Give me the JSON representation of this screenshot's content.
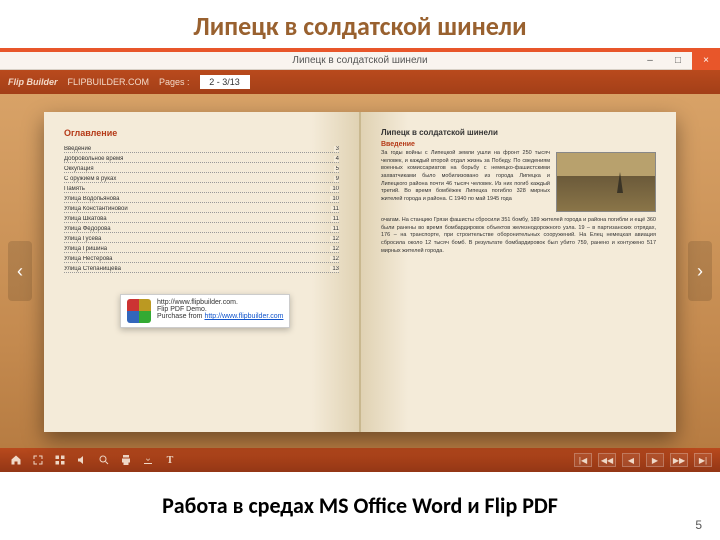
{
  "slide": {
    "title": "Липецк в солдатской шинели",
    "caption": "Работа в средах MS Office Word и Flip PDF",
    "pageNumber": "5"
  },
  "window": {
    "title": "Липецк в солдатской шинели",
    "minimize": "–",
    "maximize": "□",
    "close": "×"
  },
  "topbar": {
    "brand": "Flip Builder",
    "site": "FLIPBUILDER.COM",
    "pagesLabel": "Pages :",
    "pagesValue": "2 - 3/13"
  },
  "toc": {
    "title": "Оглавление",
    "items": [
      {
        "label": "Введение",
        "page": "3"
      },
      {
        "label": "Добровольное время",
        "page": "4"
      },
      {
        "label": "Оккупация",
        "page": "5"
      },
      {
        "label": "С оружием в руках",
        "page": "9"
      },
      {
        "label": "Память",
        "page": "10"
      },
      {
        "label": "Улица Водопьянова",
        "page": "10"
      },
      {
        "label": "Улица Константиновой",
        "page": "11"
      },
      {
        "label": "Улица Шкатова",
        "page": "11"
      },
      {
        "label": "Улица Фёдорова",
        "page": "11"
      },
      {
        "label": "Улица Гусева",
        "page": "12"
      },
      {
        "label": "Улица Гришина",
        "page": "12"
      },
      {
        "label": "Улица Нестерова",
        "page": "12"
      },
      {
        "label": "Улица Степанищева",
        "page": "13"
      }
    ]
  },
  "article": {
    "title": "Липецк в солдатской шинели",
    "sub": "Введение",
    "para1": "За годы войны с Липецкой земли ушли на фронт 250 тысяч человек, и каждый второй отдал жизнь за Победу. По сведениям военных комиссариатов на борьбу с немецко-фашистскими захватчиками было мобилизовано из города Липецка и Липецкого района почти 46 тысяч человек. Из них погиб каждый третий. Во время бомбёжек Липецка погибло 328 мирных жителей города и района. С 1940 по май 1945 года",
    "para2": "очагам. На станцию Грязи фашисты сбросили 351 бомбу, 189 жителей города и района погибли и ещё 360 были ранены во время бомбардировок объектов железнодорожного узла. 19 – в партизанских отрядах, 176 – на транспорте, при строительстве оборонительных сооружений. На Елец немецкая авиация сбросила около 12 тысяч бомб. В результате бомбардировок был убито 759, ранено и контужено 517 мирных жителей города."
  },
  "watermark": {
    "line1": "http://www.flipbuilder.com.",
    "line2": "Flip PDF Demo.",
    "line3a": "Purchase from ",
    "line3b": "http://www.flipbuilder.com"
  },
  "nav": {
    "prev": "‹",
    "next": "›"
  },
  "bottomNav": {
    "first": "|◀",
    "prev": "◀◀",
    "back": "◀",
    "fwd": "▶",
    "next": "▶▶",
    "last": "▶|"
  }
}
